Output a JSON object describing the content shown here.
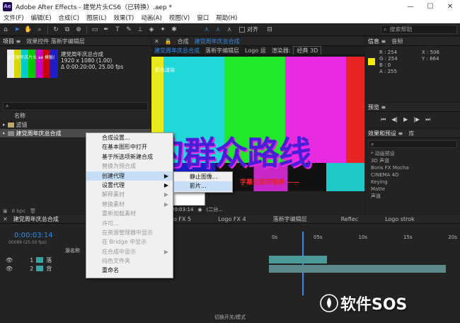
{
  "window": {
    "app_logo": "Ae",
    "title": "Adobe After Effects - 建党片头CS6（已转换）.aep *",
    "controls": [
      "—",
      "☐",
      "✕"
    ]
  },
  "menu": [
    "文件(F)",
    "编辑(E)",
    "合成(C)",
    "图层(L)",
    "效果(T)",
    "动画(A)",
    "视图(V)",
    "窗口",
    "帮助(H)"
  ],
  "toolbar": {
    "snap_label": "对齐",
    "search_placeholder": "搜索帮助"
  },
  "project_panel": {
    "tabs": [
      "项目 ≡",
      "效果控件 落新字编辑层"
    ],
    "comp_name": "建党周年庆总合成",
    "comp_size": "1920 x 1080 (1.00)",
    "comp_duration": "Δ 0:00:20:00, 25.00 fps",
    "thumb_label": "建党周年庆片头 ae 模板(",
    "search_icon": "search-icon",
    "col_name": "名称",
    "rows": [
      {
        "name": "滤镜",
        "type": "folder"
      },
      {
        "name": "建党周年庆总合成",
        "type": "comp"
      }
    ],
    "footer_bpc": "8 bpc"
  },
  "composition_panel": {
    "tab_prefix": "合成",
    "tab_name": "建党周年庆总合成",
    "sub_tabs": [
      "建党周年庆总合成",
      "落新字编辑层",
      "Logo 运",
      "渲染器:",
      "经典 3D"
    ],
    "overlay_title": "颜色渲染",
    "big_text": "的群众路线",
    "sub_text": "字幕全部可替换 ——",
    "colors": [
      "#e8e81a",
      "#20d8d8",
      "#22e82a",
      "#e82ae0",
      "#e82424",
      "#2a26d8"
    ],
    "footer": {
      "zoom": "5%",
      "timecode": "0:00:03:14",
      "res": "(二分..."
    }
  },
  "info_panel": {
    "tabs": [
      "信息 ≡",
      "音频"
    ],
    "r": "R : 254",
    "g": "G : 254",
    "b": "B : 0",
    "a": "A : 255",
    "x": "X : 506",
    "y": "Y : 664",
    "swatch": "#f7ec00"
  },
  "preview_panel": {
    "title": "预览 ≡",
    "controls": [
      "⏮",
      "◀|",
      "▶",
      "|▶",
      "⏭"
    ]
  },
  "effects_panel": {
    "tabs": [
      "效果和预设 ≡",
      "库"
    ],
    "search_icon": "search-icon",
    "items": [
      "* 动画预设",
      "3D 声道",
      "Boris FX Mocha",
      "CINEMA 4D",
      "Keying",
      "Matte",
      "声道"
    ]
  },
  "context_menu_main": {
    "items": [
      {
        "label": "合成设置...",
        "state": "normal"
      },
      {
        "label": "在基本图形中打开",
        "state": "normal"
      },
      {
        "label": "基于所选项新建合成",
        "state": "normal"
      },
      {
        "label": "替换为预合成",
        "state": "dis"
      },
      {
        "label": "创建代理",
        "state": "hl",
        "arrow": "▶"
      },
      {
        "label": "设置代理",
        "state": "normal",
        "arrow": "▶"
      },
      {
        "label": "解释素材",
        "state": "dis",
        "arrow": "▶"
      },
      {
        "label": "替换素材",
        "state": "dis",
        "arrow": "▶"
      },
      {
        "label": "重新加载素材",
        "state": "dis"
      },
      {
        "label": "许可...",
        "state": "dis"
      },
      {
        "label": "在资源管理器中显示",
        "state": "dis"
      },
      {
        "label": "在 Bridge 中显示",
        "state": "dis"
      },
      {
        "label": "在合成中显示",
        "state": "dis",
        "arrow": "▶"
      },
      {
        "label": "纯色文件夹",
        "state": "dis"
      },
      {
        "label": "重命名",
        "state": "normal"
      }
    ]
  },
  "context_menu_sub": {
    "items": [
      {
        "label": "静止图像...",
        "state": "normal"
      },
      {
        "label": "影片...",
        "state": "hl"
      }
    ]
  },
  "timeline": {
    "tab": "建党周年庆总合成",
    "tabs_right": [
      "Logo FX 5",
      "Logo FX 4",
      "落新字编辑层",
      "Reflec",
      "Logo strok"
    ],
    "timecode": "0:00:03:14",
    "fps": "00089 (25.00 fps)",
    "col_source": "源名称",
    "ruler": [
      "0s",
      "05s",
      "10s",
      "15s",
      "20s"
    ],
    "layers": [
      {
        "num": "1",
        "name": "落",
        "color": "#3aa3a3"
      },
      {
        "num": "2",
        "name": "背",
        "color": "#3aa3a3"
      }
    ],
    "footer": "切换开关/模式"
  },
  "watermark": {
    "text": "软件SOS",
    "icon": "lotus-icon"
  }
}
